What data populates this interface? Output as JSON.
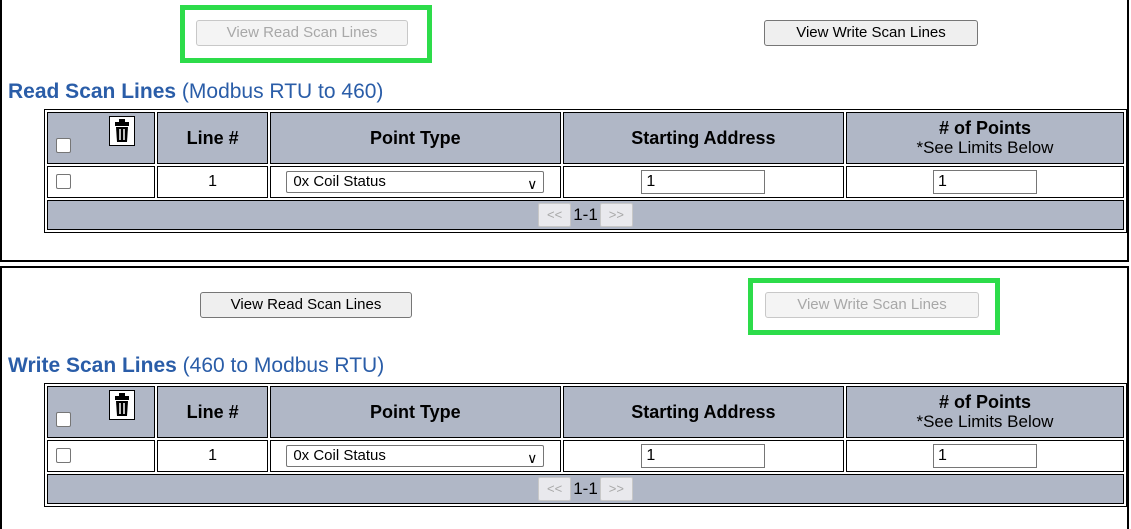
{
  "read_section": {
    "view_read_button": "View Read Scan Lines",
    "view_write_button": "View Write Scan Lines",
    "title_bold": "Read Scan Lines",
    "title_rest": " (Modbus RTU to 460)",
    "headers": {
      "line": "Line #",
      "point_type": "Point Type",
      "starting_address": "Starting Address",
      "points": "# of Points",
      "points_sub": "*See Limits Below"
    },
    "row": {
      "line": "1",
      "point_type": "0x Coil Status",
      "starting_address": "1",
      "points": "1"
    },
    "pagination": {
      "prev": "<<",
      "range": "1-1",
      "next": ">>"
    }
  },
  "write_section": {
    "view_read_button": "View Read Scan Lines",
    "view_write_button": "View Write Scan Lines",
    "title_bold": "Write Scan Lines",
    "title_rest": " (460 to Modbus RTU)",
    "headers": {
      "line": "Line #",
      "point_type": "Point Type",
      "starting_address": "Starting Address",
      "points": "# of Points",
      "points_sub": "*See Limits Below"
    },
    "row": {
      "line": "1",
      "point_type": "0x Coil Status",
      "starting_address": "1",
      "points": "1"
    },
    "pagination": {
      "prev": "<<",
      "range": "1-1",
      "next": ">>"
    }
  },
  "colors": {
    "highlight": "#2ddc4a",
    "header_bg": "#b0b7c6",
    "title": "#2a5da8"
  },
  "icons": {
    "delete": "trash-icon",
    "dropdown": "chevron-down-icon"
  }
}
